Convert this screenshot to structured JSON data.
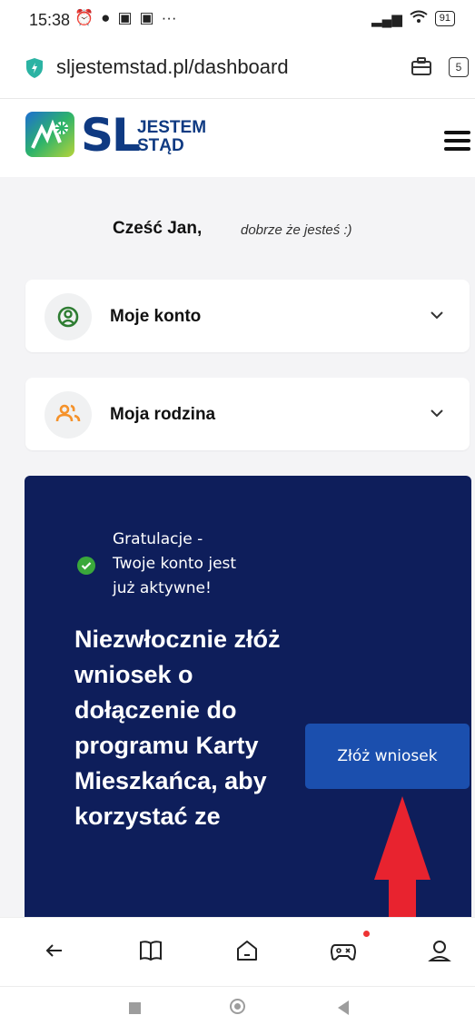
{
  "status_bar": {
    "time": "15:38",
    "battery": "91"
  },
  "browser": {
    "url": "sljestemstad.pl/dashboard",
    "tab_count": "5"
  },
  "site": {
    "logo_letters": "SL",
    "logo_line1": "JESTEM",
    "logo_line2": "STĄD"
  },
  "greeting": {
    "name": "Cześć Jan,",
    "subtitle": "dobrze że jesteś :)"
  },
  "cards": [
    {
      "label": "Moje konto",
      "icon": "user-circle-icon",
      "icon_color": "#2e7d32"
    },
    {
      "label": "Moja rodzina",
      "icon": "family-icon",
      "icon_color": "#f5922b"
    }
  ],
  "promo": {
    "status_line1": "Gratulacje -",
    "status_line2": "Twoje konto jest",
    "status_line3": "już aktywne!",
    "headline": "Niezwłocznie złóż wniosek o dołączenie do programu Karty Mieszkańca, aby korzystać ze",
    "button_label": "Złóż wniosek"
  },
  "colors": {
    "brand_blue": "#0f3a82",
    "promo_bg": "#0e1e5b",
    "button_bg": "#1b4fae",
    "success_green": "#3aa83b",
    "arrow_red": "#e8232f"
  }
}
